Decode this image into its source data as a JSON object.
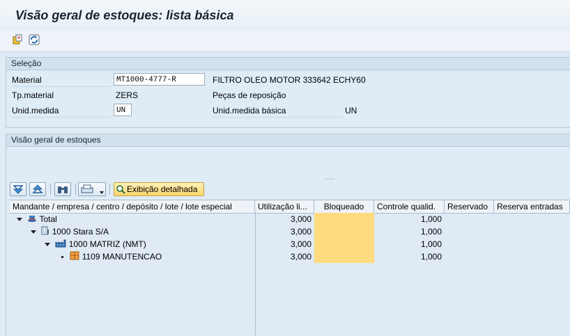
{
  "window": {
    "title": "Visão geral de estoques: lista básica"
  },
  "app_toolbar": {
    "icons": [
      "copy-icon",
      "refresh-icon"
    ]
  },
  "selection": {
    "header": "Seleção",
    "material_label": "Material",
    "material_value": "MT1000-4777-R",
    "material_desc": "FILTRO OLEO MOTOR 333642 ECHY60",
    "tp_label": "Tp.material",
    "tp_value": "ZERS",
    "tp_desc": "Peças de reposição",
    "unid_label": "Unid.medida",
    "unid_value": "UN",
    "unid_basica_label": "Unid.medida básica",
    "unid_basica_value": "UN"
  },
  "overview": {
    "header": "Visão geral de estoques",
    "handle": ".....",
    "detail_button": "Exibição detalhada"
  },
  "table": {
    "columns": [
      "Mandante / empresa / centro / depósito / lote / lote especial",
      "Utilização li...",
      "Bloqueado",
      "Controle qualid.",
      "Reservado",
      "Reserva entradas"
    ],
    "rows": [
      {
        "label": "Total",
        "util": "3,000",
        "bloq": "",
        "ctrl": "1,000",
        "icon": "hat-icon"
      },
      {
        "label": "1000 Stara S/A",
        "util": "3,000",
        "bloq": "",
        "ctrl": "1,000",
        "icon": "building-icon"
      },
      {
        "label": "1000 MATRIZ (NMT)",
        "util": "3,000",
        "bloq": "",
        "ctrl": "1,000",
        "icon": "factory-icon"
      },
      {
        "label": "1109 MANUTENCAO",
        "util": "3,000",
        "bloq": "",
        "ctrl": "1,000",
        "icon": "warehouse-icon"
      }
    ]
  }
}
